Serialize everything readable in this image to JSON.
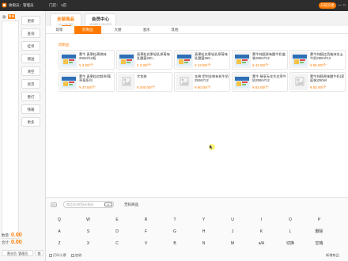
{
  "topbar": {
    "cashier_label": "收银员：",
    "cashier_name": "管理员",
    "store_label": "门店：",
    "store_name": "1店",
    "shift_button": "开班交接",
    "minimize": "—",
    "maximize": "□"
  },
  "left": {
    "cart_title": "收",
    "cart_tag": "整单",
    "functions": [
      "更新",
      "查询",
      "挂单",
      "赠送",
      "清空",
      "退货",
      "重打",
      "钱箱",
      "更多"
    ],
    "summary": {
      "count_label": "数量:",
      "count_value": "0.00",
      "total_label": "合计:",
      "total_value": "0.00"
    },
    "user_bar": "营业员: 管理员",
    "lock_label": "锁"
  },
  "main": {
    "category_tabs": [
      {
        "title": "全部商品",
        "sub": "ALL GOODS"
      },
      {
        "title": "会员中心",
        "sub": "MEMBER CENTER"
      }
    ],
    "sub_tabs": [
      "琼浆",
      "奶制品",
      "大肠",
      "酒水",
      "其他"
    ],
    "active_sub_tab": 1,
    "section_label": "奶制品",
    "products": [
      {
        "name": "蒙牛 真果粒黄桃味250ml/12瓶",
        "price": "¥ 3.50/个",
        "img": "milk-box"
      },
      {
        "name": "真果粒花果轻乳原莓味乳酸菌250...",
        "price": "¥ 3.00/个",
        "img": "milk-box"
      },
      {
        "name": "真果粒花果轻乳原莓味乳酸菌250...",
        "price": "¥ 13.90/个",
        "img": "milk-box"
      },
      {
        "name": "蒙牛纯甄原味酸牛奶盒装250ml*12",
        "price": "¥ 42.50/个",
        "img": "milk-box"
      },
      {
        "name": "蒙牛纯甄红西柚抹芝士牛奶250ml*12",
        "price": "¥ 65.00/个",
        "img": "milk-box"
      },
      {
        "name": "蒙牛 真果粒红颜/树莓草莓系列",
        "price": "¥ 37.50/个",
        "img": "milk-box"
      },
      {
        "name": "大包装",
        "price": "¥ 200.00/个",
        "img": "placeholder"
      },
      {
        "name": "金典 伊利金典有机牛奶250ml*12",
        "price": "¥ 60.00/个",
        "img": "placeholder"
      },
      {
        "name": "蒙牛 臻享无花生红枣牛奶250ml*12",
        "price": "¥ 62.00/个",
        "img": "milk-box"
      },
      {
        "name": "蒙牛纯甄原味酸牛奶(家庭装)250ml",
        "price": "¥ 53.00/个",
        "img": "placeholder"
      }
    ],
    "total_count": "共：11条"
  },
  "keyboard": {
    "search_placeholder": "商品名/拼音码/条码",
    "clear_label": "×",
    "extra_label": "无码商品",
    "rows": [
      [
        "Q",
        "W",
        "E",
        "R",
        "T",
        "Y",
        "U",
        "I",
        "O",
        "P"
      ],
      [
        "A",
        "S",
        "D",
        "F",
        "G",
        "H",
        "J",
        "K",
        "L",
        "删除"
      ],
      [
        "Z",
        "X",
        "C",
        "V",
        "B",
        "N",
        "M",
        "a/A",
        "切换",
        "空格"
      ]
    ],
    "option_print": "打印小票",
    "option_weigh": "加收",
    "right_link": "新增商品"
  }
}
